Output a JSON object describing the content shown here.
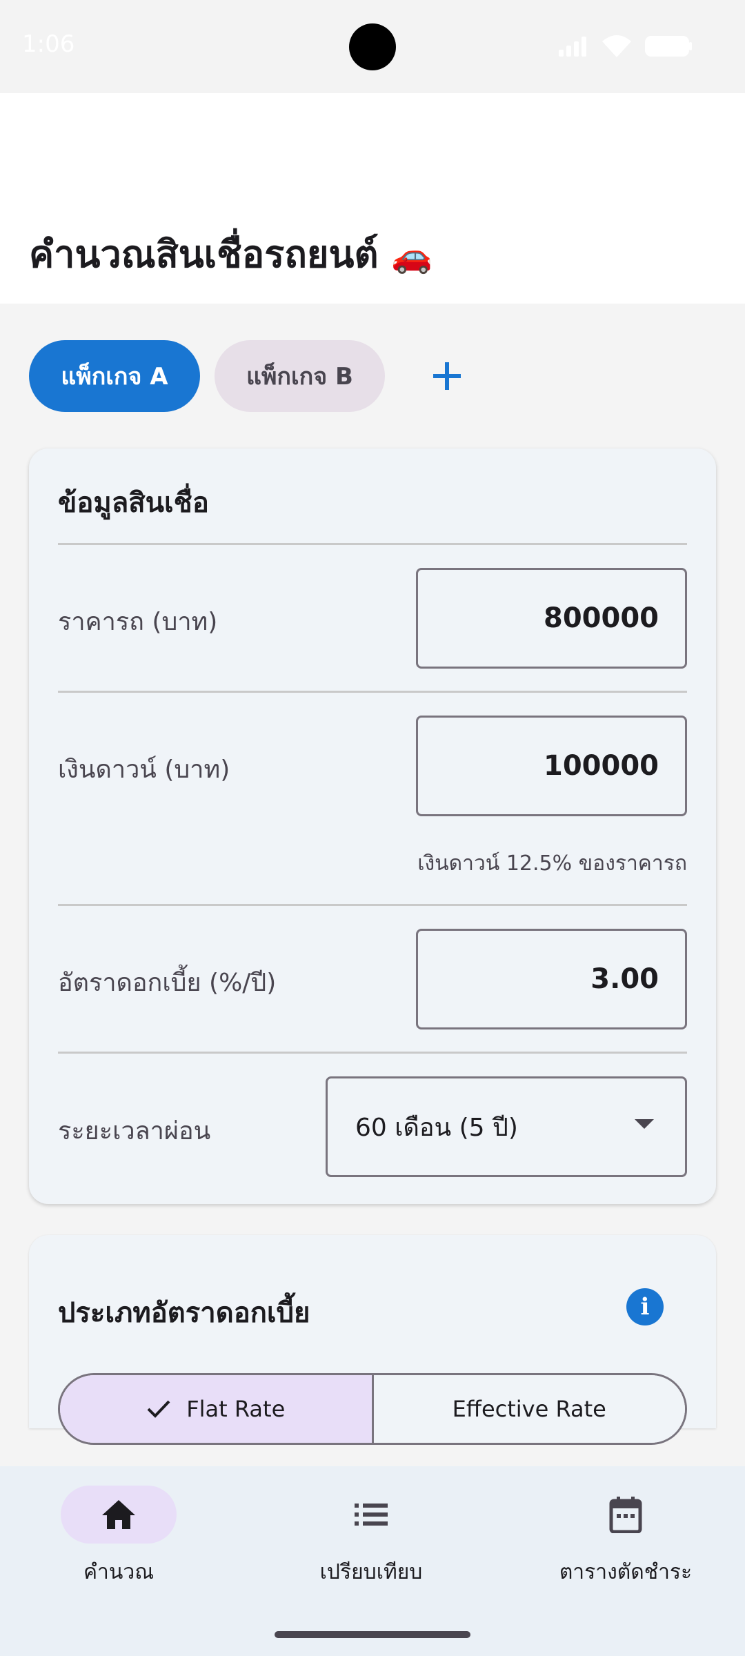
{
  "status_bar": {
    "time": "1:06"
  },
  "app_bar": {
    "title": "คำนวณสินเชื่อรถยนต์",
    "title_emoji": "🚗"
  },
  "packages": {
    "items": [
      {
        "label": "แพ็กเกจ A",
        "selected": true
      },
      {
        "label": "แพ็กเกจ B",
        "selected": false
      }
    ],
    "add_icon": "plus-icon"
  },
  "loan_info": {
    "title": "ข้อมูลสินเชื่อ",
    "car_price": {
      "label": "ราคารถ (บาท)",
      "value": "800000"
    },
    "down_payment": {
      "label": "เงินดาวน์ (บาท)",
      "value": "100000",
      "helper": "เงินดาวน์ 12.5% ของราคารถ"
    },
    "interest_rate": {
      "label": "อัตราดอกเบี้ย (%/ปี)",
      "value": "3.00"
    },
    "term": {
      "label": "ระยะเวลาผ่อน",
      "selected": "60 เดือน (5 ปี)"
    }
  },
  "rate_type": {
    "title": "ประเภทอัตราดอกเบี้ย",
    "info_icon": "info-icon",
    "options": [
      {
        "label": "Flat Rate",
        "selected": true
      },
      {
        "label": "Effective Rate",
        "selected": false
      }
    ]
  },
  "bottom_nav": {
    "items": [
      {
        "label": "คำนวณ",
        "icon": "home-icon",
        "active": true
      },
      {
        "label": "เปรียบเทียบ",
        "icon": "list-icon",
        "active": false
      },
      {
        "label": "ตารางตัดชำระ",
        "icon": "calendar-icon",
        "active": false
      }
    ]
  },
  "colors": {
    "primary": "#1976d2",
    "chip_unselected": "#e7dfe8",
    "segment_selected": "#e8def8",
    "card_background": "#f0f4f8",
    "nav_background": "#eaf0f6"
  }
}
